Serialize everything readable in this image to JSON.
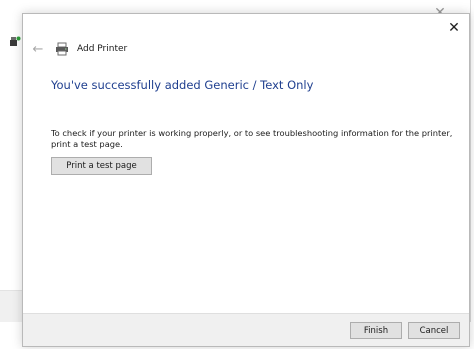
{
  "dialog": {
    "title": "Add Printer",
    "heading": "You've successfully added Generic / Text Only",
    "info_text": "To check if your printer is working properly, or to see troubleshooting information for the printer, print a test page.",
    "print_test_label": "Print a test page",
    "finish_label": "Finish",
    "cancel_label": "Cancel",
    "close_glyph": "✕",
    "back_glyph": "←"
  },
  "background_window": {
    "close_glyph": "✕"
  },
  "icons": {
    "back": "back-arrow-icon",
    "printer": "printer-icon",
    "close": "close-icon",
    "bg_printer": "printer-icon"
  },
  "colors": {
    "heading": "#1f3f8f",
    "button_bg": "#e1e1e1",
    "footer_bg": "#f0f0f0",
    "printer_status_green": "#2e9e3a"
  }
}
